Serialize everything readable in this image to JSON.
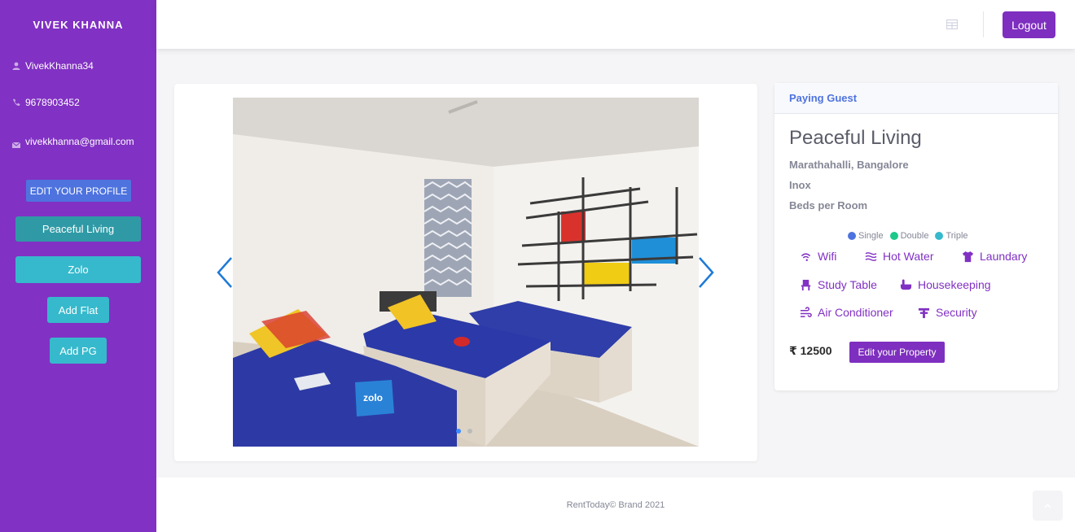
{
  "sidebar": {
    "brand": "VIVEK KHANNA",
    "username": "VivekKhanna34",
    "phone": "9678903452",
    "email": "vivekkhanna@gmail.com",
    "edit_profile": "EDIT YOUR PROFILE",
    "properties": [
      "Peaceful Living",
      "Zolo"
    ],
    "add_flat": "Add Flat",
    "add_pg": "Add PG"
  },
  "topbar": {
    "logout": "Logout"
  },
  "carousel": {
    "image_label": "zolo",
    "slide_count": 2,
    "active_slide": 1
  },
  "property": {
    "category": "Paying Guest",
    "name": "Peaceful Living",
    "location": "Marathahalli, Bangalore",
    "landmark": "Inox",
    "beds_label": "Beds per Room",
    "legend": [
      {
        "label": "Single",
        "color": "#4e73df"
      },
      {
        "label": "Double",
        "color": "#1cc88a"
      },
      {
        "label": "Triple",
        "color": "#36b9cc"
      }
    ],
    "amenities": [
      {
        "label": "Wifi",
        "icon": "wifi-icon"
      },
      {
        "label": "Hot Water",
        "icon": "hot-water-icon"
      },
      {
        "label": "Laundary",
        "icon": "tshirt-icon"
      },
      {
        "label": "Study Table",
        "icon": "chair-icon"
      },
      {
        "label": "Housekeeping",
        "icon": "bath-icon"
      },
      {
        "label": "Air Conditioner",
        "icon": "wind-icon"
      },
      {
        "label": "Security",
        "icon": "security-icon"
      }
    ],
    "price": "₹ 12500",
    "edit_button": "Edit your Property"
  },
  "footer": {
    "text": "RentToday© Brand 2021"
  },
  "colors": {
    "sidebar": "#8131c3",
    "primary": "#4e73df",
    "accent": "#7e2fbf",
    "info": "#36b9cc"
  }
}
